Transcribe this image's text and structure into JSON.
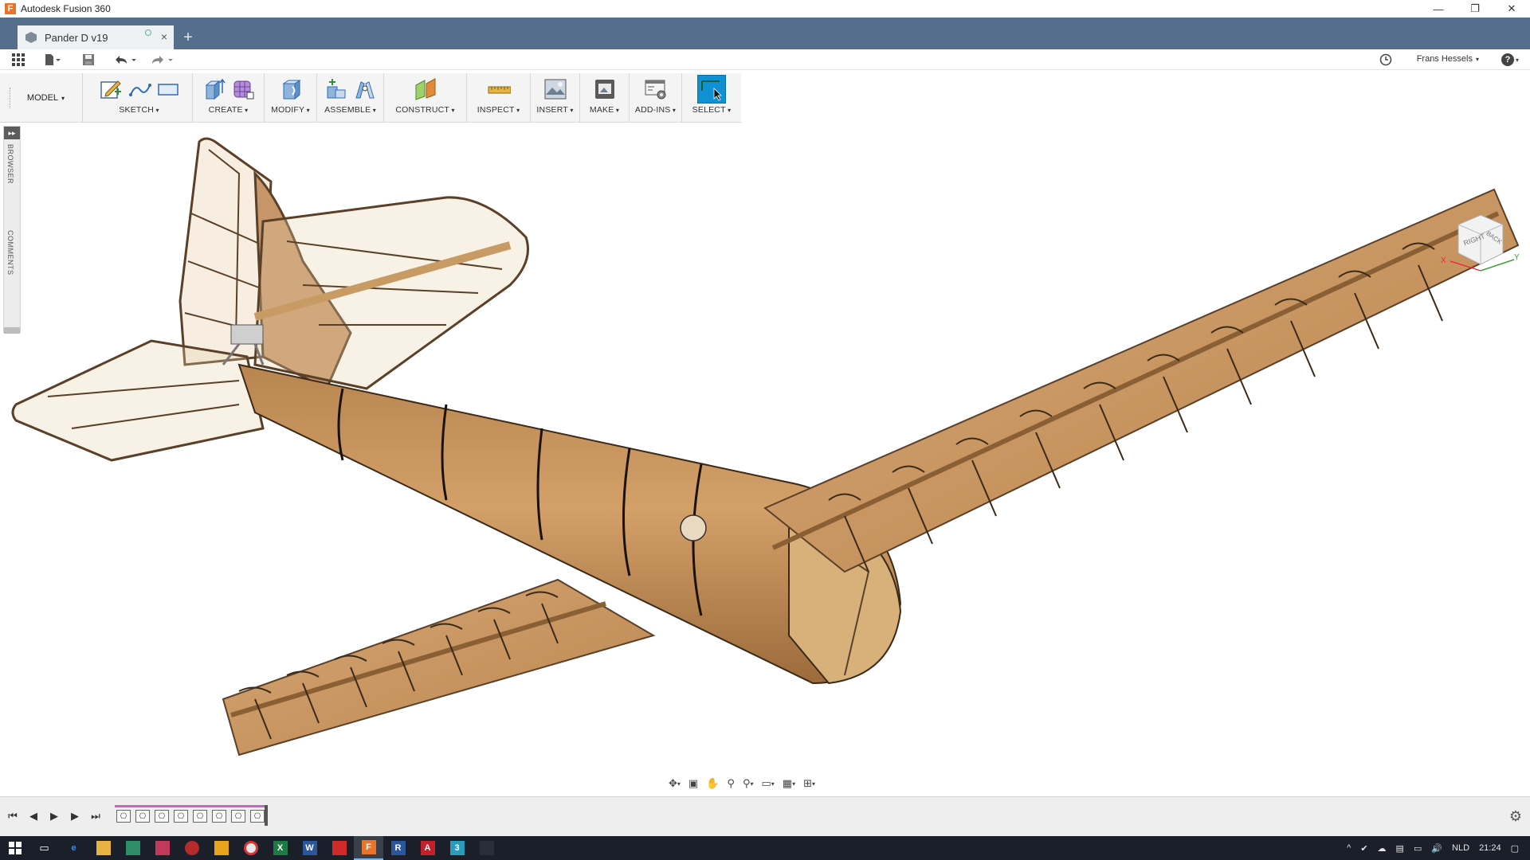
{
  "window": {
    "title": "Autodesk Fusion 360",
    "logo_letter": "F",
    "controls": [
      "—",
      "❐",
      "✕"
    ]
  },
  "tabs": {
    "active_tab_label": "Pander D v19",
    "close_glyph": "×",
    "new_tab_glyph": "+"
  },
  "quick_access": {
    "user_name": "Frans Hessels",
    "help_glyph": "?",
    "user_caret": "▾"
  },
  "ribbon": {
    "workspace": "MODEL",
    "groups": [
      {
        "label": "SKETCH"
      },
      {
        "label": "CREATE"
      },
      {
        "label": "MODIFY"
      },
      {
        "label": "ASSEMBLE"
      },
      {
        "label": "CONSTRUCT"
      },
      {
        "label": "INSPECT"
      },
      {
        "label": "INSERT"
      },
      {
        "label": "MAKE"
      },
      {
        "label": "ADD-INS"
      },
      {
        "label": "SELECT"
      }
    ]
  },
  "browser_panel": {
    "expand_glyph": "▸▸",
    "browser_label": "BROWSER",
    "comments_label": "COMMENTS"
  },
  "viewcube": {
    "right_label": "RIGHT",
    "back_label": "BACK",
    "axis_x": "X",
    "axis_y": "Y"
  },
  "timeline": {
    "feature_count": 8,
    "settings_glyph": "⚙"
  },
  "taskbar": {
    "language": "NLD",
    "time": "21:24"
  },
  "colors": {
    "tabbar": "#546e8c",
    "select_active": "#0f91d4",
    "timeline_bar": "#c95fc9",
    "model_wood": "#c8945e"
  }
}
